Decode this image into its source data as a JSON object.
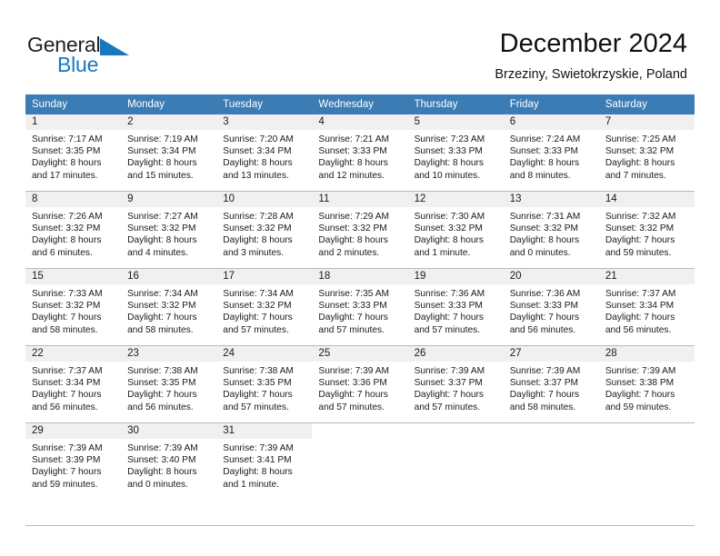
{
  "brand": {
    "name_part1": "General",
    "name_part2": "Blue",
    "accent_color": "#1878be",
    "logo_icon": "triangle-flag-icon"
  },
  "header": {
    "title": "December 2024",
    "subtitle": "Brzeziny, Swietokrzyskie, Poland"
  },
  "calendar": {
    "header_bg": "#3b7cb5",
    "daynum_band_bg": "#f0f0f0",
    "weekday_headers": [
      "Sunday",
      "Monday",
      "Tuesday",
      "Wednesday",
      "Thursday",
      "Friday",
      "Saturday"
    ],
    "weeks": [
      [
        {
          "day": "1",
          "sunrise": "Sunrise: 7:17 AM",
          "sunset": "Sunset: 3:35 PM",
          "daylight_line1": "Daylight: 8 hours",
          "daylight_line2": "and 17 minutes."
        },
        {
          "day": "2",
          "sunrise": "Sunrise: 7:19 AM",
          "sunset": "Sunset: 3:34 PM",
          "daylight_line1": "Daylight: 8 hours",
          "daylight_line2": "and 15 minutes."
        },
        {
          "day": "3",
          "sunrise": "Sunrise: 7:20 AM",
          "sunset": "Sunset: 3:34 PM",
          "daylight_line1": "Daylight: 8 hours",
          "daylight_line2": "and 13 minutes."
        },
        {
          "day": "4",
          "sunrise": "Sunrise: 7:21 AM",
          "sunset": "Sunset: 3:33 PM",
          "daylight_line1": "Daylight: 8 hours",
          "daylight_line2": "and 12 minutes."
        },
        {
          "day": "5",
          "sunrise": "Sunrise: 7:23 AM",
          "sunset": "Sunset: 3:33 PM",
          "daylight_line1": "Daylight: 8 hours",
          "daylight_line2": "and 10 minutes."
        },
        {
          "day": "6",
          "sunrise": "Sunrise: 7:24 AM",
          "sunset": "Sunset: 3:33 PM",
          "daylight_line1": "Daylight: 8 hours",
          "daylight_line2": "and 8 minutes."
        },
        {
          "day": "7",
          "sunrise": "Sunrise: 7:25 AM",
          "sunset": "Sunset: 3:32 PM",
          "daylight_line1": "Daylight: 8 hours",
          "daylight_line2": "and 7 minutes."
        }
      ],
      [
        {
          "day": "8",
          "sunrise": "Sunrise: 7:26 AM",
          "sunset": "Sunset: 3:32 PM",
          "daylight_line1": "Daylight: 8 hours",
          "daylight_line2": "and 6 minutes."
        },
        {
          "day": "9",
          "sunrise": "Sunrise: 7:27 AM",
          "sunset": "Sunset: 3:32 PM",
          "daylight_line1": "Daylight: 8 hours",
          "daylight_line2": "and 4 minutes."
        },
        {
          "day": "10",
          "sunrise": "Sunrise: 7:28 AM",
          "sunset": "Sunset: 3:32 PM",
          "daylight_line1": "Daylight: 8 hours",
          "daylight_line2": "and 3 minutes."
        },
        {
          "day": "11",
          "sunrise": "Sunrise: 7:29 AM",
          "sunset": "Sunset: 3:32 PM",
          "daylight_line1": "Daylight: 8 hours",
          "daylight_line2": "and 2 minutes."
        },
        {
          "day": "12",
          "sunrise": "Sunrise: 7:30 AM",
          "sunset": "Sunset: 3:32 PM",
          "daylight_line1": "Daylight: 8 hours",
          "daylight_line2": "and 1 minute."
        },
        {
          "day": "13",
          "sunrise": "Sunrise: 7:31 AM",
          "sunset": "Sunset: 3:32 PM",
          "daylight_line1": "Daylight: 8 hours",
          "daylight_line2": "and 0 minutes."
        },
        {
          "day": "14",
          "sunrise": "Sunrise: 7:32 AM",
          "sunset": "Sunset: 3:32 PM",
          "daylight_line1": "Daylight: 7 hours",
          "daylight_line2": "and 59 minutes."
        }
      ],
      [
        {
          "day": "15",
          "sunrise": "Sunrise: 7:33 AM",
          "sunset": "Sunset: 3:32 PM",
          "daylight_line1": "Daylight: 7 hours",
          "daylight_line2": "and 58 minutes."
        },
        {
          "day": "16",
          "sunrise": "Sunrise: 7:34 AM",
          "sunset": "Sunset: 3:32 PM",
          "daylight_line1": "Daylight: 7 hours",
          "daylight_line2": "and 58 minutes."
        },
        {
          "day": "17",
          "sunrise": "Sunrise: 7:34 AM",
          "sunset": "Sunset: 3:32 PM",
          "daylight_line1": "Daylight: 7 hours",
          "daylight_line2": "and 57 minutes."
        },
        {
          "day": "18",
          "sunrise": "Sunrise: 7:35 AM",
          "sunset": "Sunset: 3:33 PM",
          "daylight_line1": "Daylight: 7 hours",
          "daylight_line2": "and 57 minutes."
        },
        {
          "day": "19",
          "sunrise": "Sunrise: 7:36 AM",
          "sunset": "Sunset: 3:33 PM",
          "daylight_line1": "Daylight: 7 hours",
          "daylight_line2": "and 57 minutes."
        },
        {
          "day": "20",
          "sunrise": "Sunrise: 7:36 AM",
          "sunset": "Sunset: 3:33 PM",
          "daylight_line1": "Daylight: 7 hours",
          "daylight_line2": "and 56 minutes."
        },
        {
          "day": "21",
          "sunrise": "Sunrise: 7:37 AM",
          "sunset": "Sunset: 3:34 PM",
          "daylight_line1": "Daylight: 7 hours",
          "daylight_line2": "and 56 minutes."
        }
      ],
      [
        {
          "day": "22",
          "sunrise": "Sunrise: 7:37 AM",
          "sunset": "Sunset: 3:34 PM",
          "daylight_line1": "Daylight: 7 hours",
          "daylight_line2": "and 56 minutes."
        },
        {
          "day": "23",
          "sunrise": "Sunrise: 7:38 AM",
          "sunset": "Sunset: 3:35 PM",
          "daylight_line1": "Daylight: 7 hours",
          "daylight_line2": "and 56 minutes."
        },
        {
          "day": "24",
          "sunrise": "Sunrise: 7:38 AM",
          "sunset": "Sunset: 3:35 PM",
          "daylight_line1": "Daylight: 7 hours",
          "daylight_line2": "and 57 minutes."
        },
        {
          "day": "25",
          "sunrise": "Sunrise: 7:39 AM",
          "sunset": "Sunset: 3:36 PM",
          "daylight_line1": "Daylight: 7 hours",
          "daylight_line2": "and 57 minutes."
        },
        {
          "day": "26",
          "sunrise": "Sunrise: 7:39 AM",
          "sunset": "Sunset: 3:37 PM",
          "daylight_line1": "Daylight: 7 hours",
          "daylight_line2": "and 57 minutes."
        },
        {
          "day": "27",
          "sunrise": "Sunrise: 7:39 AM",
          "sunset": "Sunset: 3:37 PM",
          "daylight_line1": "Daylight: 7 hours",
          "daylight_line2": "and 58 minutes."
        },
        {
          "day": "28",
          "sunrise": "Sunrise: 7:39 AM",
          "sunset": "Sunset: 3:38 PM",
          "daylight_line1": "Daylight: 7 hours",
          "daylight_line2": "and 59 minutes."
        }
      ],
      [
        {
          "day": "29",
          "sunrise": "Sunrise: 7:39 AM",
          "sunset": "Sunset: 3:39 PM",
          "daylight_line1": "Daylight: 7 hours",
          "daylight_line2": "and 59 minutes."
        },
        {
          "day": "30",
          "sunrise": "Sunrise: 7:39 AM",
          "sunset": "Sunset: 3:40 PM",
          "daylight_line1": "Daylight: 8 hours",
          "daylight_line2": "and 0 minutes."
        },
        {
          "day": "31",
          "sunrise": "Sunrise: 7:39 AM",
          "sunset": "Sunset: 3:41 PM",
          "daylight_line1": "Daylight: 8 hours",
          "daylight_line2": "and 1 minute."
        },
        {
          "day": "",
          "sunrise": "",
          "sunset": "",
          "daylight_line1": "",
          "daylight_line2": ""
        },
        {
          "day": "",
          "sunrise": "",
          "sunset": "",
          "daylight_line1": "",
          "daylight_line2": ""
        },
        {
          "day": "",
          "sunrise": "",
          "sunset": "",
          "daylight_line1": "",
          "daylight_line2": ""
        },
        {
          "day": "",
          "sunrise": "",
          "sunset": "",
          "daylight_line1": "",
          "daylight_line2": ""
        }
      ]
    ]
  }
}
